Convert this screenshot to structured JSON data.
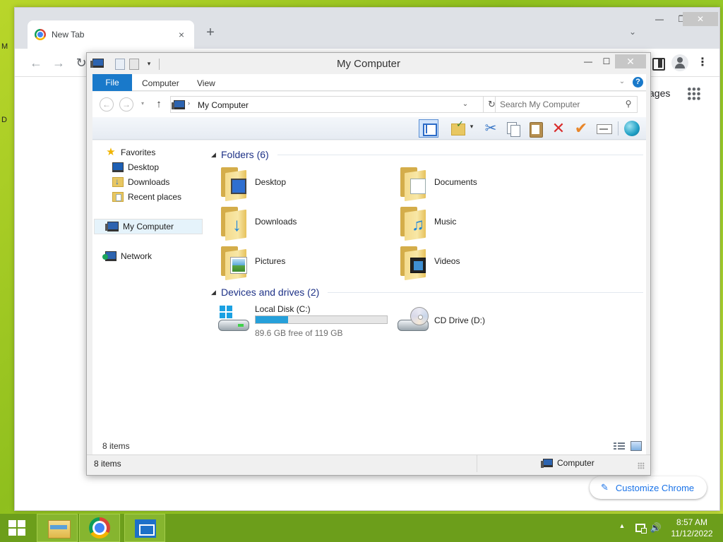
{
  "desktop": {
    "edge_text_1": "M",
    "edge_text_2": "D"
  },
  "chrome": {
    "tab_title": "New Tab",
    "tab_close": "×",
    "new_tab": "+",
    "tab_search": "⌄",
    "minimize": "—",
    "restore": "❐",
    "close": "✕",
    "back": "←",
    "forward": "→",
    "reload": "↻",
    "menu": "⋮",
    "images_link": "ages",
    "customize_label": "Customize Chrome",
    "customize_icon": "✎"
  },
  "explorer": {
    "title": "My Computer",
    "minimize": "—",
    "maximize": "☐",
    "close": "✕",
    "quick_access_dropdown": "▾",
    "ribbon_tabs": {
      "file": "File",
      "computer": "Computer",
      "view": "View"
    },
    "ribbon_toggle": "⌄",
    "help": "?",
    "nav_back": "←",
    "nav_forward": "→",
    "nav_recent": "▾",
    "nav_up": "↑",
    "address": {
      "chevron": "›",
      "path": "My Computer",
      "dropdown": "⌄"
    },
    "refresh": "↻",
    "search": {
      "placeholder": "Search My Computer",
      "icon": "⚲"
    },
    "toolbar": {
      "cut": "✂",
      "delete": "✕",
      "check": "✔",
      "folder_dropdown": "▾"
    },
    "nav_pane": {
      "favorites": "Favorites",
      "desktop": "Desktop",
      "downloads": "Downloads",
      "recent_places": "Recent places",
      "my_computer": "My Computer",
      "network": "Network",
      "favorites_icon": "★"
    },
    "groups": {
      "collapse_glyph": "◢",
      "folders": "Folders (6)",
      "devices": "Devices and drives (2)"
    },
    "folders": [
      {
        "name": "Desktop"
      },
      {
        "name": "Documents"
      },
      {
        "name": "Downloads"
      },
      {
        "name": "Music"
      },
      {
        "name": "Pictures"
      },
      {
        "name": "Videos"
      }
    ],
    "drives": [
      {
        "name": "Local Disk (C:)",
        "free": "89.6 GB free of 119 GB",
        "used_fraction": 0.247
      },
      {
        "name": "CD Drive (D:)"
      }
    ],
    "info_count": "8 items",
    "status_count": "8 items",
    "status_location": "Computer"
  },
  "taskbar": {
    "tray_chevron": "▲",
    "volume": "🔊",
    "time": "8:57 AM",
    "date": "11/12/2022"
  },
  "colors": {
    "accent": "#1979ca",
    "desktop_green": "#8fbf1e",
    "taskbar_green": "#6c9e1b",
    "drive_bar": "#26a0da"
  }
}
